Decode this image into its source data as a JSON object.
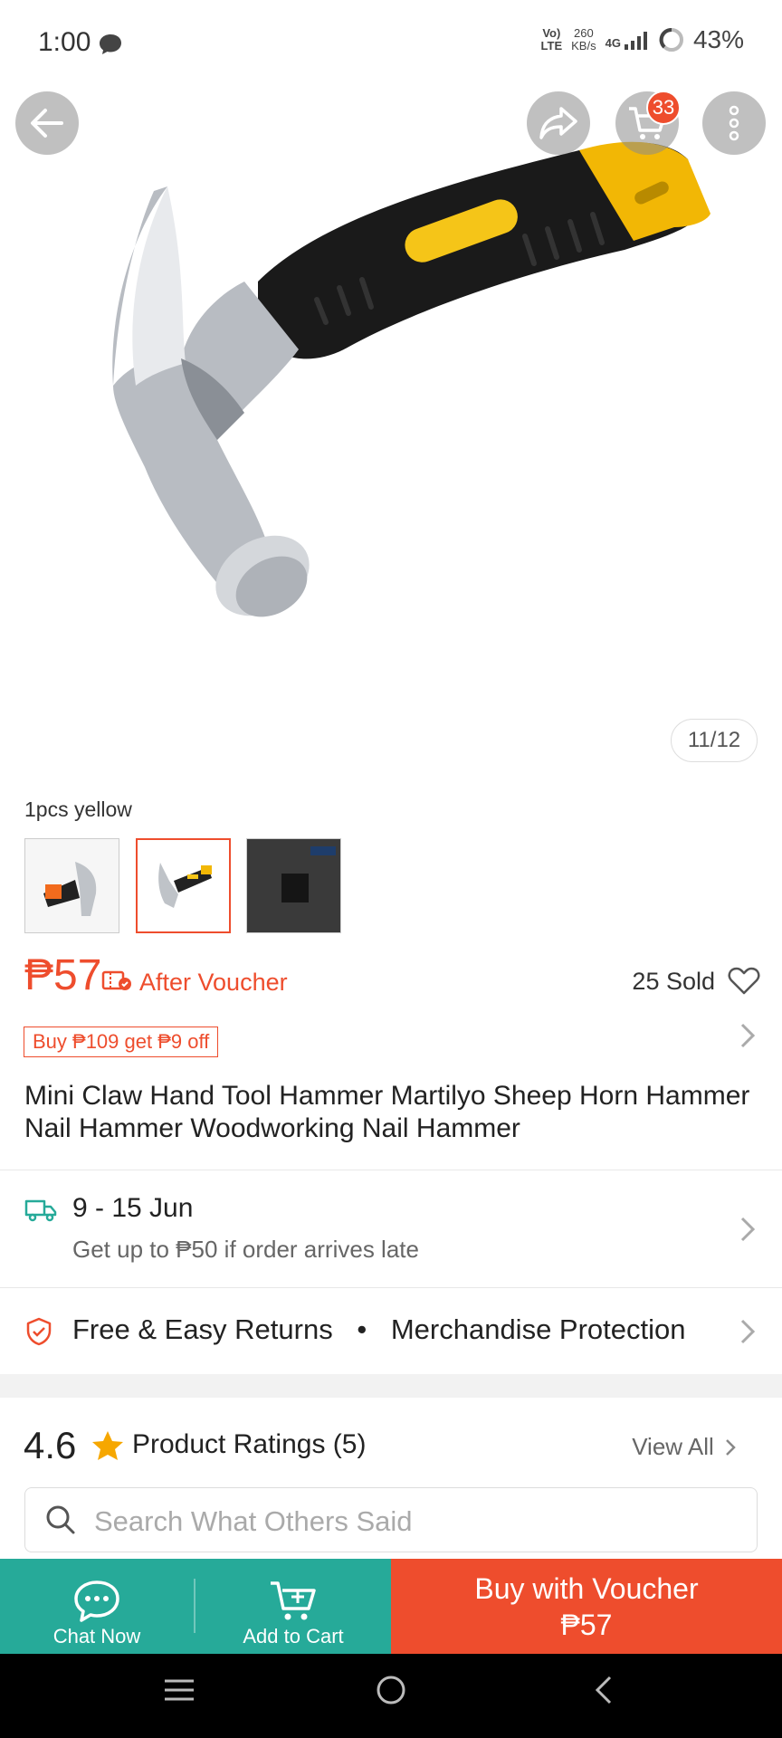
{
  "status_bar": {
    "time": "1:00",
    "network_top": "Vo)",
    "network_bottom": "LTE",
    "speed_value": "260",
    "speed_unit": "KB/s",
    "signal_label": "4G",
    "battery": "43%"
  },
  "header": {
    "cart_count": "33",
    "image_counter": "11/12"
  },
  "variant": {
    "label": "1pcs yellow",
    "thumbnails": [
      "thumb-orange-hammer",
      "thumb-yellow-hammer",
      "thumb-dark-box"
    ],
    "selected_index": 1
  },
  "price": {
    "amount": "₱57",
    "after_voucher": "After Voucher",
    "sold": "25 Sold"
  },
  "promo": {
    "tag": "Buy ₱109 get ₱9 off"
  },
  "product": {
    "title": "Mini Claw Hand Tool Hammer Martilyo Sheep Horn Hammer Nail Hammer Woodworking Nail Hammer"
  },
  "shipping": {
    "date": "9 - 15 Jun",
    "note": "Get up to ₱50 if order arrives late"
  },
  "guarantee": {
    "text_1": "Free & Easy Returns",
    "separator": "•",
    "text_2": "Merchandise Protection"
  },
  "ratings": {
    "score": "4.6",
    "label": "Product Ratings (5)",
    "view_all": "View All",
    "search_placeholder": "Search What Others Said"
  },
  "action_bar": {
    "chat_label": "Chat Now",
    "cart_label": "Add to Cart",
    "buy_label": "Buy with Voucher",
    "buy_price": "₱57"
  },
  "colors": {
    "brand": "#ee4d2d",
    "teal": "#26aa99"
  }
}
